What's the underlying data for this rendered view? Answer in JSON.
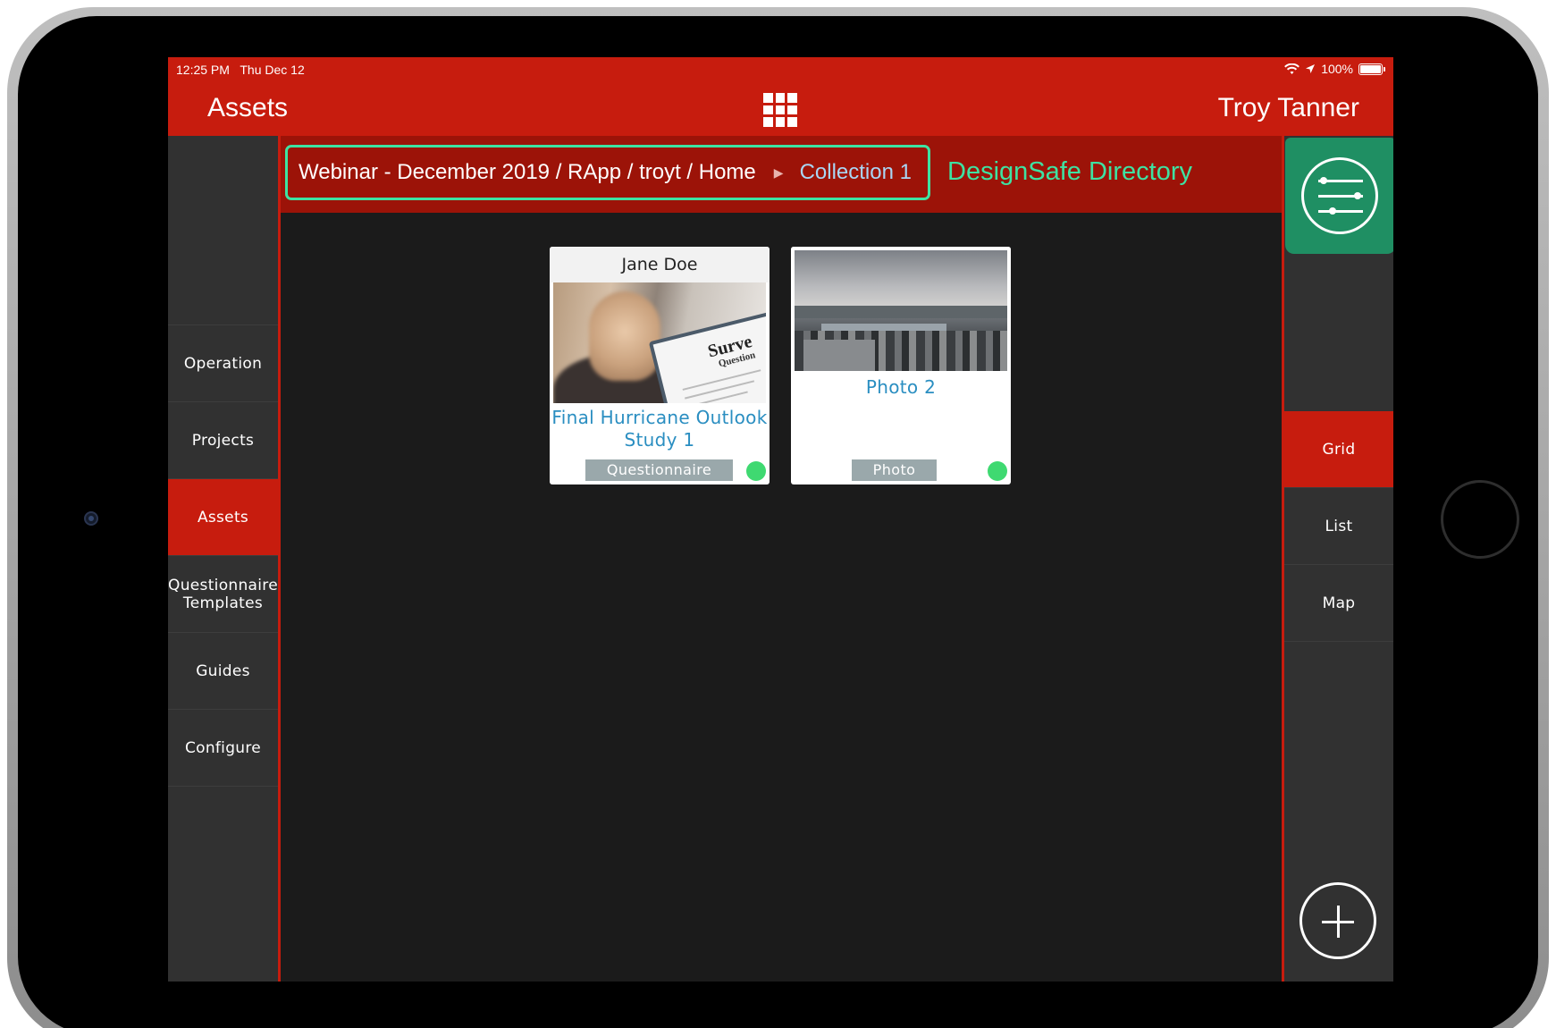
{
  "status_bar": {
    "time": "12:25 PM",
    "date": "Thu Dec 12",
    "battery": "100%",
    "icons": [
      "wifi-icon",
      "location-arrow-icon",
      "battery-icon"
    ]
  },
  "nav": {
    "title": "Assets",
    "user": "Troy Tanner",
    "menu_icon": "grid-menu-icon"
  },
  "sidebar": {
    "items": [
      {
        "label": "Operation",
        "active": false
      },
      {
        "label": "Projects",
        "active": false
      },
      {
        "label": "Assets",
        "active": true
      },
      {
        "label": "Questionnaire Templates",
        "active": false
      },
      {
        "label": "Guides",
        "active": false
      },
      {
        "label": "Configure",
        "active": false
      }
    ]
  },
  "breadcrumb": {
    "path": "Webinar - December 2019 / RApp / troyt / Home",
    "separator_icon": "triangle-right-icon",
    "current": "Collection 1",
    "annotation": "DesignSafe Directory"
  },
  "assets": [
    {
      "owner": "Jane Doe",
      "title": "Final Hurricane Outlook Study 1",
      "type": "Questionnaire",
      "thumb_text_1": "Surve",
      "thumb_text_2": "Question",
      "status_color": "#3fd971"
    },
    {
      "owner": "",
      "title": "Photo 2",
      "type": "Photo",
      "status_color": "#3fd971"
    }
  ],
  "right_rail": {
    "filter_icon": "sliders-filter-icon",
    "views": [
      {
        "label": "Grid",
        "active": true
      },
      {
        "label": "List",
        "active": false
      },
      {
        "label": "Map",
        "active": false
      }
    ],
    "add_icon": "plus-circle-icon"
  },
  "colors": {
    "brand_red": "#c71c0e",
    "breadcrumb_bg": "#9c1308",
    "highlight_green": "#3ee2a2",
    "filter_green": "#1f8f63",
    "link_blue": "#2a8ec1"
  }
}
